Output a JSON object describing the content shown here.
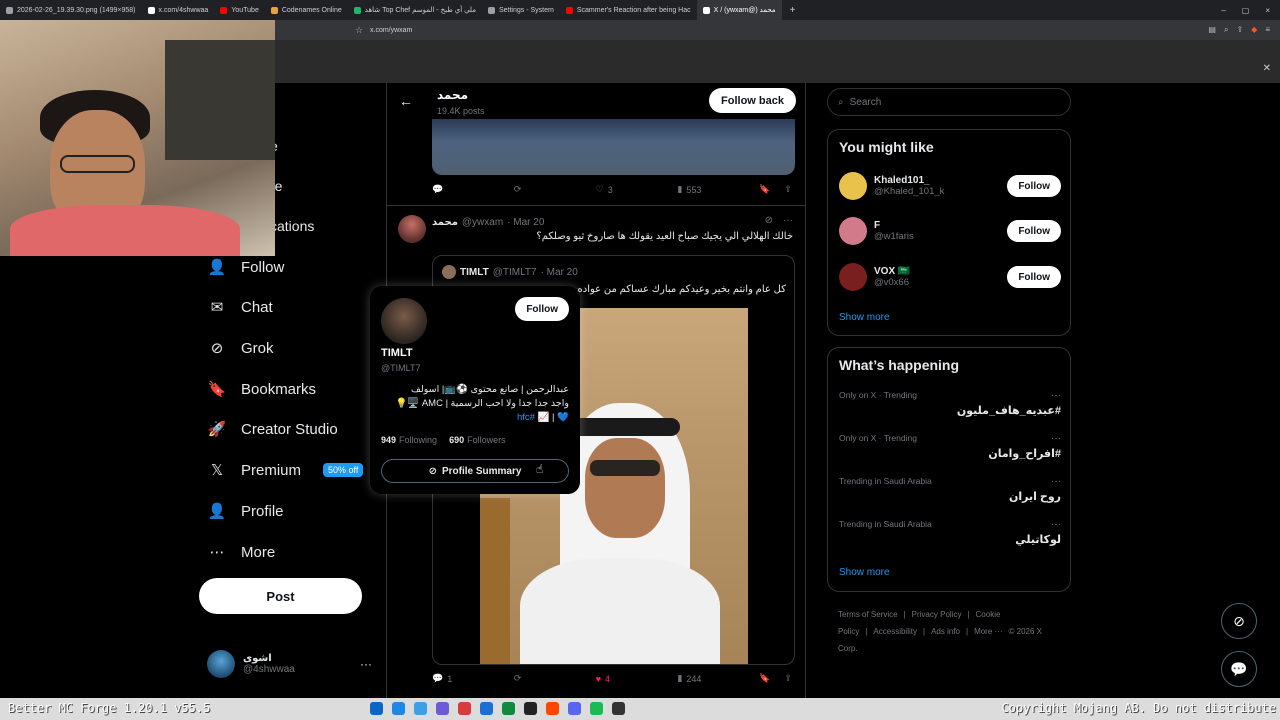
{
  "browser": {
    "tabs": [
      {
        "label": "2026-02-26_19.39.30.png (1499×958)",
        "color": "#9aa0a6"
      },
      {
        "label": "x.com/4shwwaa",
        "color": "#ffffff"
      },
      {
        "label": "YouTube",
        "color": "#ff0000"
      },
      {
        "label": "Codenames Online",
        "color": "#e8a33d"
      },
      {
        "label": "شاهد Top Chef ملي أي طبخ - الموسم",
        "color": "#23b26d"
      },
      {
        "label": "Settings - System",
        "color": "#9aa0a6"
      },
      {
        "label": "Scammer's Reaction after being Hac",
        "color": "#ff0000"
      },
      {
        "label": "X / (ywxam@) محمد",
        "color": "#ffffff"
      }
    ],
    "new_tab": "+",
    "address": "x.com/ywxam",
    "window_controls": [
      "–",
      "▢",
      "×"
    ]
  },
  "sidebar": {
    "partials": [
      "e",
      "re",
      "cations"
    ],
    "items": [
      {
        "label": "Follow",
        "icon": "person-plus-icon",
        "glyph": "👤"
      },
      {
        "label": "Chat",
        "icon": "mail-icon",
        "glyph": "✉"
      },
      {
        "label": "Grok",
        "icon": "grok-icon",
        "glyph": "⊘"
      },
      {
        "label": "Bookmarks",
        "icon": "bookmark-icon",
        "glyph": "🔖"
      },
      {
        "label": "Creator Studio",
        "icon": "rocket-icon",
        "glyph": "🚀"
      },
      {
        "label": "Premium",
        "icon": "x-logo-icon",
        "glyph": "𝕏",
        "badge": "50% off"
      },
      {
        "label": "Profile",
        "icon": "person-icon",
        "glyph": "👤"
      },
      {
        "label": "More",
        "icon": "more-circle-icon",
        "glyph": "⋯"
      }
    ],
    "post_button": "Post",
    "account": {
      "name": "اشوى",
      "handle": "@4shwwaa",
      "dots": "···"
    }
  },
  "header": {
    "name": "محمد",
    "posts": "19.4K posts",
    "follow_back": "Follow back"
  },
  "tweet1": {
    "replies": "",
    "retweets": "",
    "likes": "3",
    "views": "553"
  },
  "tweet2": {
    "name": "محمد",
    "handle": "@ywxam",
    "date": "· Mar 20",
    "text": "خالك الهلالي الي يجيك صباح العيد يقولك ها صاروخ ثيو وصلكم؟",
    "quote": {
      "name": "TIMLT",
      "handle": "@TIMLT7",
      "date": "· Mar 20",
      "text": "كل عام وانتم بخير وعيدكم مبارك عساكم من عواده"
    },
    "replies": "1",
    "retweets": "",
    "likes": "4",
    "views": "244"
  },
  "hovercard": {
    "follow": "Follow",
    "name": "TIMLT",
    "handle": "@TIMLT7",
    "bio_line1": "عبدالرحمن | صانع محتوى ⚽️📺| اسولف",
    "bio_line2": "واجد جدا جدا ولا احب الرسمية | AMC 🖥️💡",
    "bio_tag": "#hfc",
    "bio_line3_suffix": "💙 | 📈",
    "following_count": "949",
    "following_label": "Following",
    "followers_count": "690",
    "followers_label": "Followers",
    "summary": "Profile Summary"
  },
  "right": {
    "search_placeholder": "Search",
    "you_might_like": "You might like",
    "suggestions": [
      {
        "name": "Khaled101_",
        "handle": "@Khaled_101_k",
        "follow": "Follow",
        "color": "#e8c24a"
      },
      {
        "name": "F",
        "handle": "@w1faris",
        "follow": "Follow",
        "color": "#d27a8a"
      },
      {
        "name": "VOX 🇸🇦",
        "handle": "@v0x66",
        "follow": "Follow",
        "color": "#7a1f1f"
      }
    ],
    "show_more": "Show more",
    "whats_happening": "What’s happening",
    "trends": [
      {
        "context": "Only on X · Trending",
        "title": "#عبديه_هاف_مليون"
      },
      {
        "context": "Only on X · Trending",
        "title": "#افراح_وامان"
      },
      {
        "context": "Trending in Saudi Arabia",
        "title": "روح ايران"
      },
      {
        "context": "Trending in Saudi Arabia",
        "title": "لوكاتيلي"
      }
    ],
    "show_more_2": "Show more",
    "footer": [
      "Terms of Service",
      "|",
      "Privacy Policy",
      "|",
      "Cookie Policy",
      "|",
      "Accessibility",
      "|",
      "Ads info",
      "|",
      "More ···",
      "© 2026 X Corp."
    ]
  },
  "taskbar": {
    "left_text": "Better MC Forge 1.20.1 v55.5",
    "right_text": "Copyright Mojang AB. Do not distribute"
  }
}
